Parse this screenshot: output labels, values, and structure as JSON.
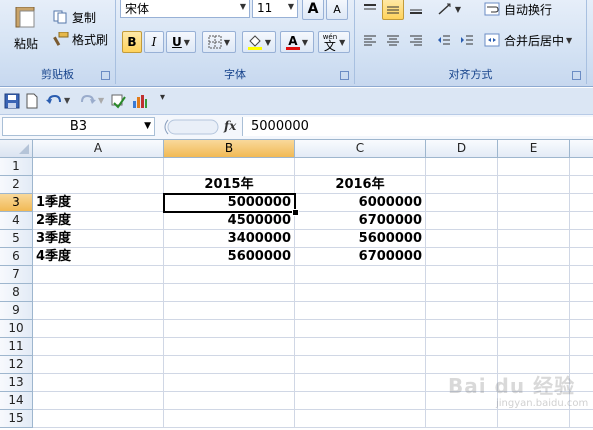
{
  "ribbon": {
    "clipboard": {
      "paste_label": "粘贴",
      "copy_label": "复制",
      "format_painter_label": "格式刷",
      "group_label": "剪贴板"
    },
    "font": {
      "font_name": "宋体",
      "font_size": "11",
      "bold": "B",
      "italic": "I",
      "underline": "U",
      "grow": "A",
      "shrink": "A",
      "font_color_glyph": "A",
      "phonetic": "wén",
      "phonetic_glyph": "文",
      "group_label": "字体"
    },
    "alignment": {
      "wrap_text_label": "自动换行",
      "merge_center_label": "合并后居中",
      "group_label": "对齐方式"
    }
  },
  "formula_bar": {
    "name_box": "B3",
    "fx_label": "fx",
    "value": "5000000"
  },
  "grid": {
    "columns": [
      "A",
      "B",
      "C",
      "D",
      "E"
    ],
    "rows": [
      "1",
      "2",
      "3",
      "4",
      "5",
      "6",
      "7",
      "8",
      "9",
      "10",
      "11",
      "12",
      "13",
      "14",
      "15"
    ],
    "cells": {
      "B2": "2015年",
      "C2": "2016年",
      "A3": "1季度",
      "B3": "5000000",
      "C3": "6000000",
      "A4": "2季度",
      "B4": "4500000",
      "C4": "6700000",
      "A5": "3季度",
      "B5": "3400000",
      "C5": "5600000",
      "A6": "4季度",
      "B6": "5600000",
      "C6": "6700000"
    },
    "active_cell": "B3"
  },
  "watermark": {
    "text": "Bai du 经验",
    "sub": "jingyan.baidu.com"
  },
  "colors": {
    "ribbon_text": "#15428b",
    "active_header": "#f1b955",
    "grid_line": "#d0d7e5"
  }
}
